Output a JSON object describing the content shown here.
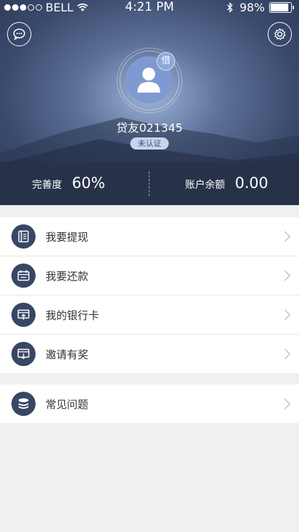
{
  "status_bar": {
    "carrier": "BELL",
    "time": "4:21 PM",
    "battery": "98%",
    "battery_level": 0.98
  },
  "profile": {
    "borrow_badge": "借",
    "username": "贷友021345",
    "verify_status": "未认证"
  },
  "stats": {
    "completeness_label": "完善度",
    "completeness_value": "60%",
    "balance_label": "账户余额",
    "balance_value": "0.00"
  },
  "menu": {
    "group1": [
      {
        "label": "我要提现",
        "icon": "withdraw-icon"
      },
      {
        "label": "我要还款",
        "icon": "calendar-icon"
      },
      {
        "label": "我的银行卡",
        "icon": "bank-card-icon"
      },
      {
        "label": "邀请有奖",
        "icon": "invite-icon"
      }
    ],
    "group2": [
      {
        "label": "常见问题",
        "icon": "database-icon"
      }
    ]
  },
  "colors": {
    "header_dark": "#2e3b58",
    "icon_bg": "#384764",
    "avatar_bg": "#7f9ad0",
    "page_bg": "#f0f0f0"
  }
}
